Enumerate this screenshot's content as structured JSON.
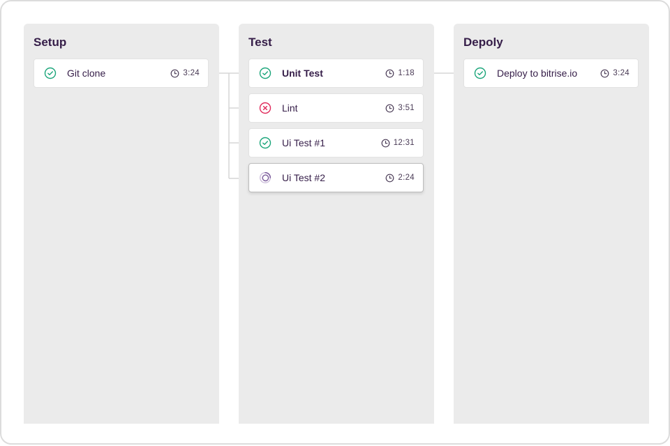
{
  "stages": [
    {
      "title": "Setup",
      "jobs": [
        {
          "name": "Git clone",
          "status": "success",
          "status_icon": "check-circle-icon",
          "duration": "3:24"
        }
      ]
    },
    {
      "title": "Test",
      "jobs": [
        {
          "name": "Unit Test",
          "status": "success",
          "status_icon": "check-circle-icon",
          "duration": "1:18",
          "emphasized": true
        },
        {
          "name": "Lint",
          "status": "failed",
          "status_icon": "x-circle-icon",
          "duration": "3:51"
        },
        {
          "name": "Ui Test #1",
          "status": "success",
          "status_icon": "check-circle-icon",
          "duration": "12:31"
        },
        {
          "name": "Ui Test #2",
          "status": "running",
          "status_icon": "spinner-icon",
          "duration": "2:24",
          "selected": true
        }
      ]
    },
    {
      "title": "Depoly",
      "jobs": [
        {
          "name": "Deploy to bitrise.io",
          "status": "success",
          "status_icon": "check-circle-icon",
          "duration": "3:24"
        }
      ]
    }
  ],
  "colors": {
    "success": "#1aa57a",
    "failed": "#e0295a",
    "running": "#7b5b9b",
    "text": "#351d48",
    "stage_bg": "#ebebeb",
    "connector": "#d6d6d6"
  }
}
